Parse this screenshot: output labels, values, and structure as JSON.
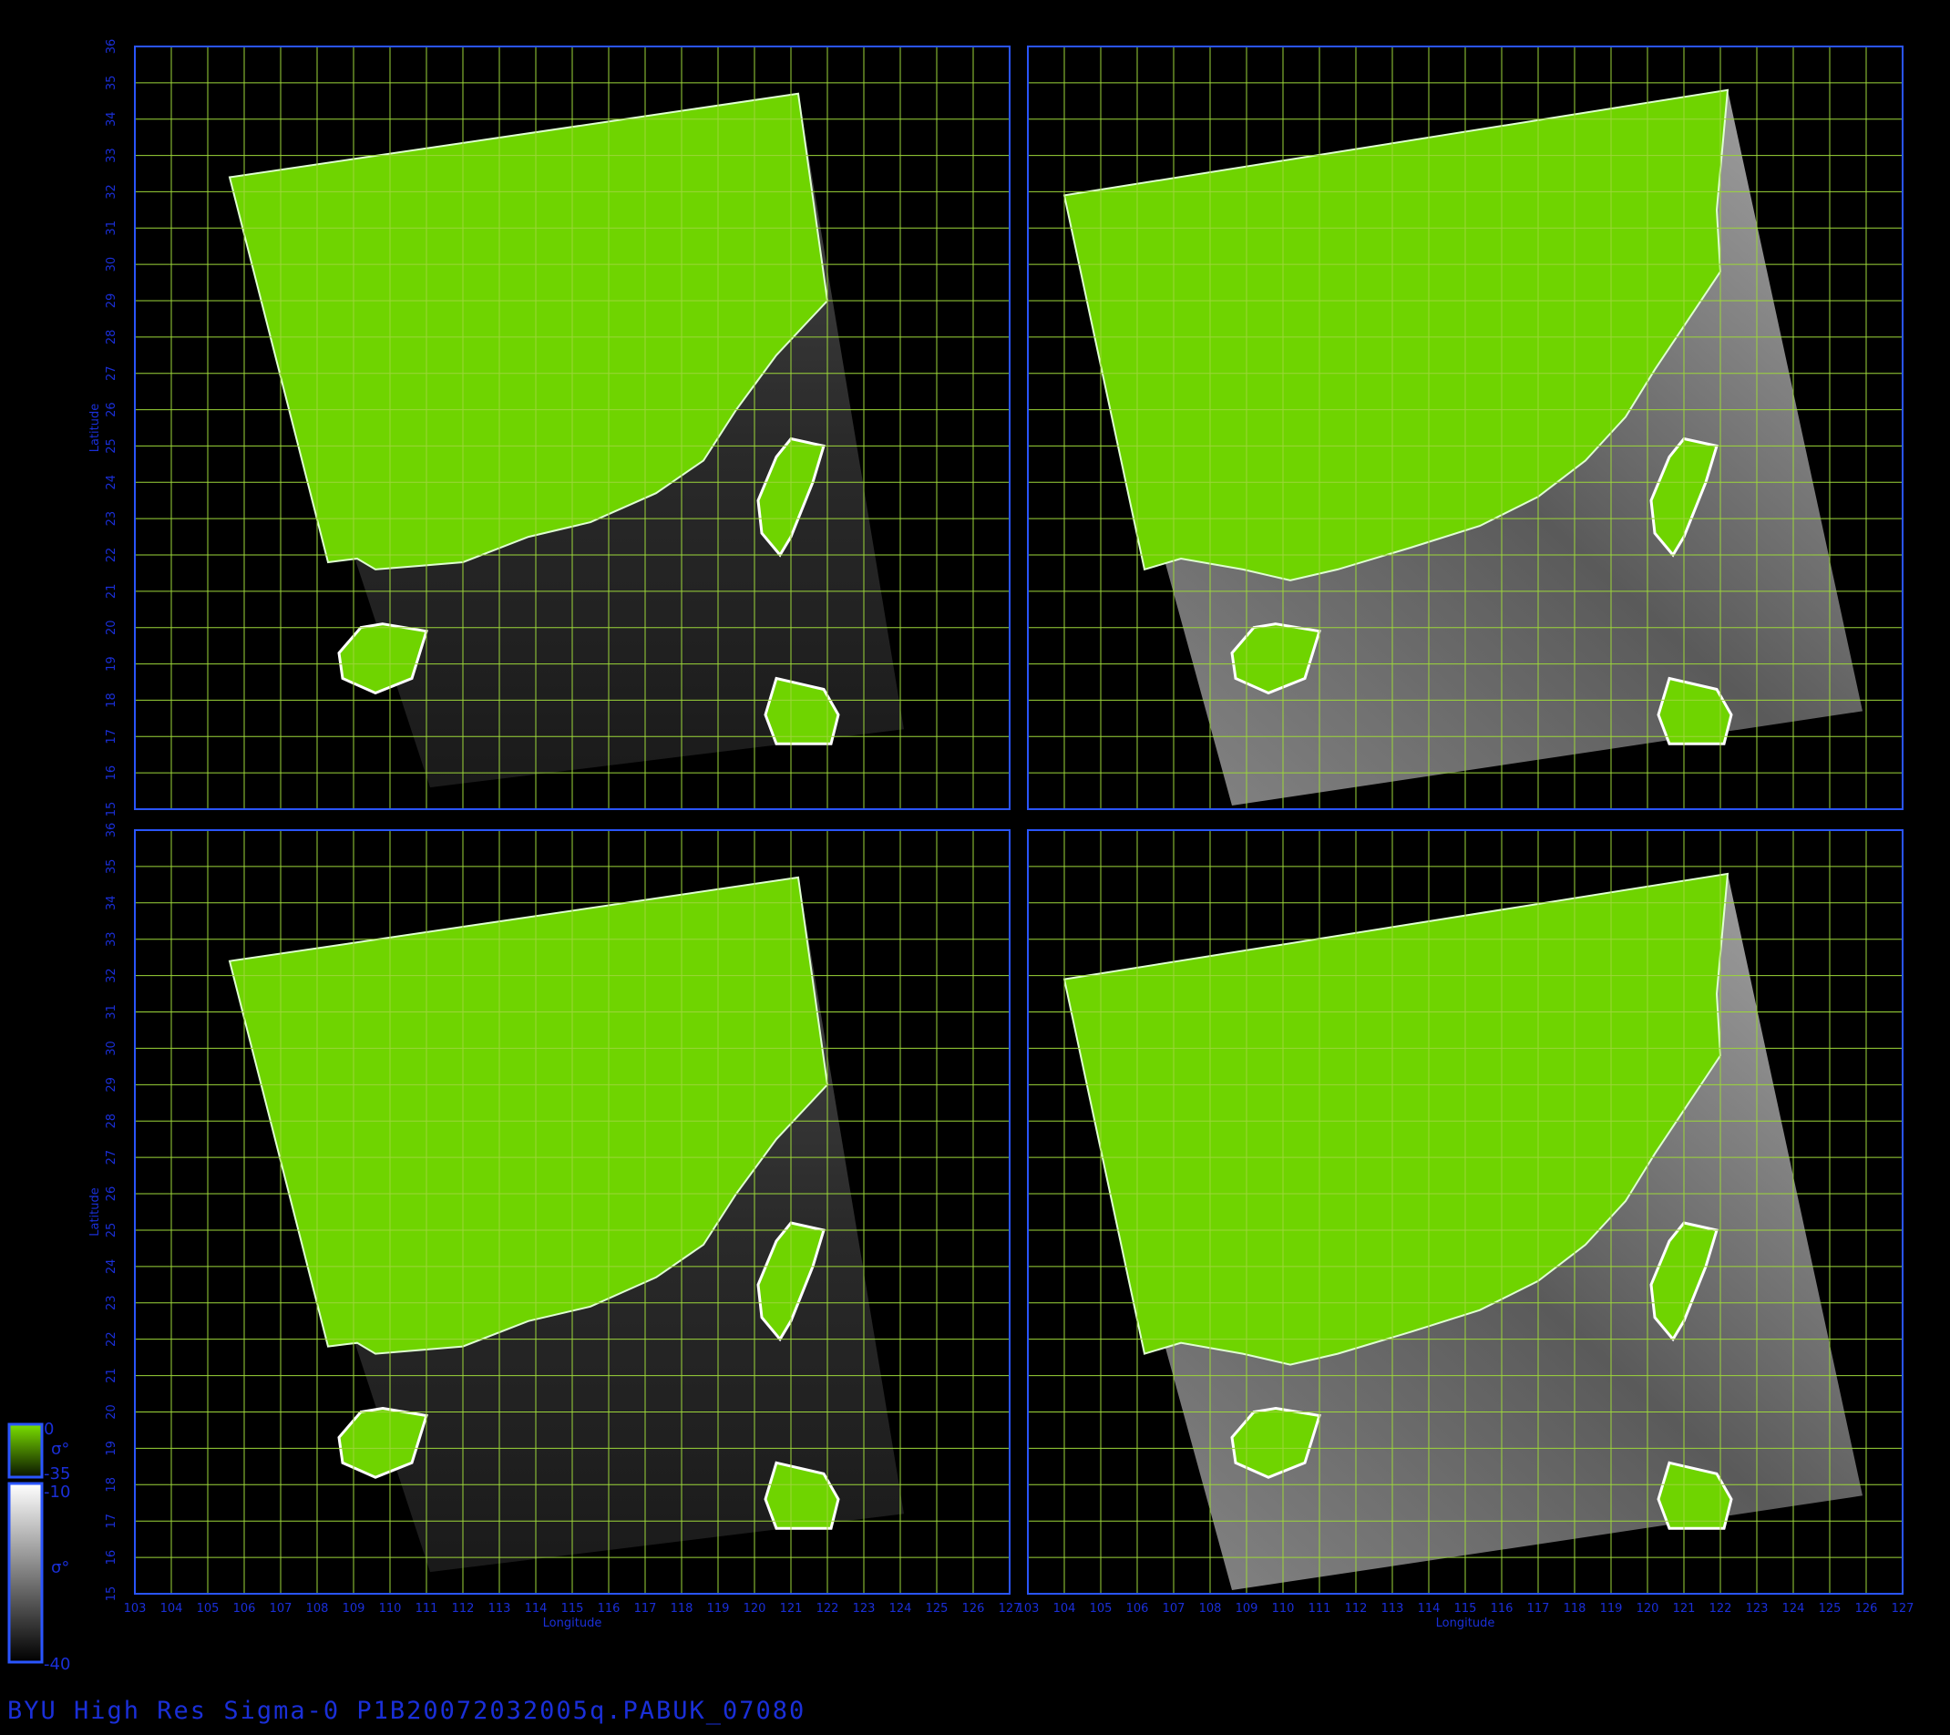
{
  "title": "BYU High Res Sigma-0 P1B20072032005q.PABUK_07080",
  "axes": {
    "xlabel": "Longitude",
    "ylabel": "Latitude",
    "lon_range": [
      103,
      127
    ],
    "lat_range": [
      15,
      36
    ],
    "lon_ticks": [
      "103",
      "104",
      "105",
      "106",
      "107",
      "108",
      "109",
      "110",
      "111",
      "112",
      "113",
      "114",
      "115",
      "116",
      "117",
      "118",
      "119",
      "120",
      "121",
      "122",
      "123",
      "124",
      "125",
      "126",
      "127"
    ],
    "lat_ticks": [
      "15",
      "16",
      "17",
      "18",
      "19",
      "20",
      "21",
      "22",
      "23",
      "24",
      "25",
      "26",
      "27",
      "28",
      "29",
      "30",
      "31",
      "32",
      "33",
      "34",
      "35",
      "36"
    ]
  },
  "legend": {
    "land_top": "0",
    "land_symbol": "σ°",
    "land_bottom": "-35",
    "ocean_top": "-10",
    "ocean_symbol": "σ°",
    "ocean_bottom": "-40"
  },
  "colors": {
    "frame": "#2a55ff",
    "grid": "#9cd63a",
    "tick_text": "#1a2fd8",
    "land": "#6fd400",
    "background": "#000000"
  },
  "panels": [
    {
      "id": "top-left"
    },
    {
      "id": "top-right"
    },
    {
      "id": "bottom-left"
    },
    {
      "id": "bottom-right"
    }
  ]
}
